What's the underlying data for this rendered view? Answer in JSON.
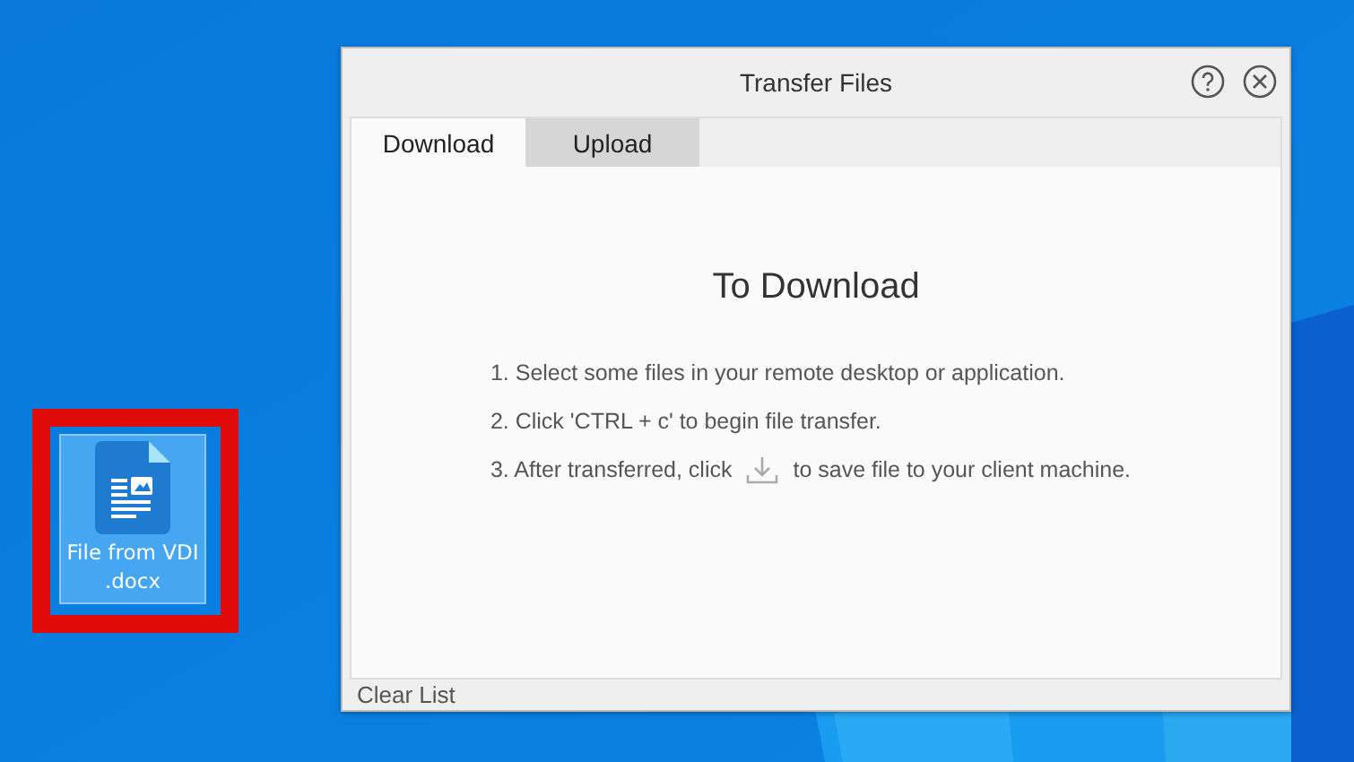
{
  "desktop_icon": {
    "label_lines": [
      "File from VDI",
      ".docx"
    ],
    "selected": true,
    "highlighted": true
  },
  "window": {
    "title": "Transfer Files",
    "tabs": [
      {
        "label": "Download",
        "selected": true
      },
      {
        "label": "Upload",
        "selected": false
      }
    ],
    "heading": "To Download",
    "steps": [
      {
        "kind": "text",
        "text": "1. Select some files in your remote desktop or application."
      },
      {
        "kind": "text",
        "text": "2. Click 'CTRL + c' to begin file transfer."
      },
      {
        "kind": "icon",
        "before": "3. After transferred, click",
        "after": "to save file to your client machine."
      }
    ],
    "footer_button": "Clear List"
  }
}
